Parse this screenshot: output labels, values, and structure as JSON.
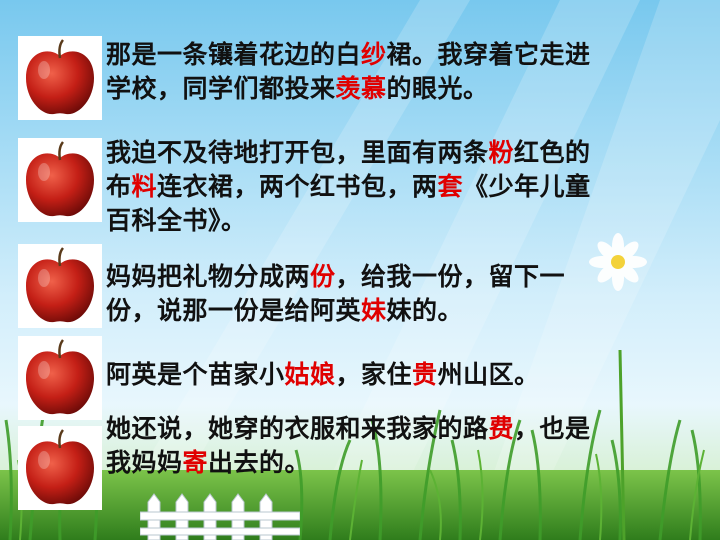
{
  "colors": {
    "text": "#111111",
    "highlight": "#e00000",
    "sky": "#a6dcf5",
    "grass": "#3f9d2a"
  },
  "icons": [
    "apple-icon",
    "daisy-flower-icon",
    "white-fence-icon",
    "grass-icon"
  ],
  "paragraphs": [
    {
      "lines": [
        [
          {
            "t": "那是一条镶着花边的白"
          },
          {
            "t": "纱",
            "hl": true
          },
          {
            "t": "裙。我穿着它走进"
          }
        ],
        [
          {
            "t": "学校，同学们都投来"
          },
          {
            "t": "羡慕",
            "hl": true
          },
          {
            "t": "的眼光。"
          }
        ]
      ]
    },
    {
      "lines": [
        [
          {
            "t": "我迫不及待地打开包，里面有两条"
          },
          {
            "t": "粉",
            "hl": true
          },
          {
            "t": "红色的"
          }
        ],
        [
          {
            "t": "布"
          },
          {
            "t": "料",
            "hl": true
          },
          {
            "t": "连衣裙，两个红书包，两"
          },
          {
            "t": "套",
            "hl": true
          },
          {
            "t": "《少年儿童"
          }
        ],
        [
          {
            "t": "百科全书》。"
          }
        ]
      ]
    },
    {
      "lines": [
        [
          {
            "t": "妈妈把礼物分成两"
          },
          {
            "t": "份",
            "hl": true
          },
          {
            "t": "，给我一份，留下一"
          }
        ],
        [
          {
            "t": "份，说那一份是给阿英"
          },
          {
            "t": "妹",
            "hl": true
          },
          {
            "t": "妹的。"
          }
        ]
      ]
    },
    {
      "lines": [
        [
          {
            "t": "阿英是个苗家小"
          },
          {
            "t": "姑娘",
            "hl": true
          },
          {
            "t": "，家住"
          },
          {
            "t": "贵",
            "hl": true
          },
          {
            "t": "州山区。"
          }
        ]
      ]
    },
    {
      "lines": [
        [
          {
            "t": "她还说，她穿的衣服和来我家的路"
          },
          {
            "t": "费",
            "hl": true
          },
          {
            "t": "，也是"
          }
        ],
        [
          {
            "t": "我妈妈"
          },
          {
            "t": "寄",
            "hl": true
          },
          {
            "t": "出去的。"
          }
        ]
      ]
    }
  ]
}
